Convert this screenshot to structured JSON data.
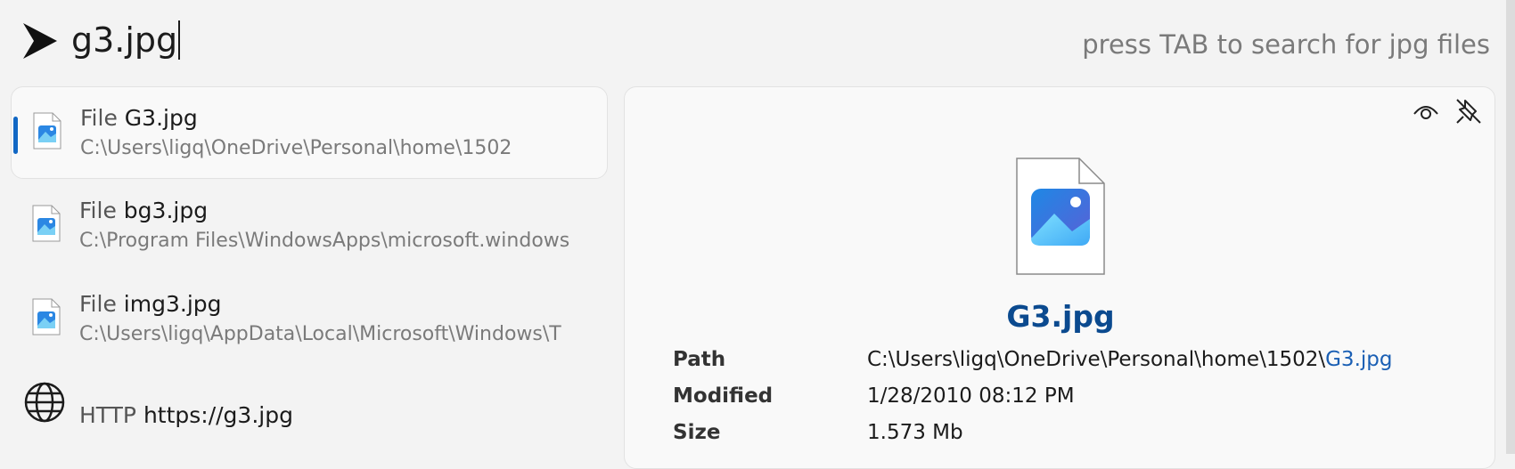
{
  "search": {
    "query": "g3.jpg",
    "hint": "press TAB to search for jpg files",
    "prompt_icon": "chevron-right-icon"
  },
  "results": [
    {
      "kind": "File",
      "name": "G3.jpg",
      "path": "C:\\Users\\ligq\\OneDrive\\Personal\\home\\1502",
      "icon": "image-file-icon",
      "selected": true
    },
    {
      "kind": "File",
      "name": "bg3.jpg",
      "path": "C:\\Program Files\\WindowsApps\\microsoft.windows",
      "icon": "image-file-icon",
      "selected": false
    },
    {
      "kind": "File",
      "name": "img3.jpg",
      "path": "C:\\Users\\ligq\\AppData\\Local\\Microsoft\\Windows\\T",
      "icon": "image-file-icon",
      "selected": false
    },
    {
      "kind": "HTTP",
      "name": "https://g3.jpg",
      "icon": "globe-icon",
      "selected": false
    }
  ],
  "preview": {
    "title": "G3.jpg",
    "path_label": "Path",
    "path_prefix": "C:\\Users\\ligq\\OneDrive\\Personal\\home\\1502\\",
    "path_file": "G3.jpg",
    "modified_label": "Modified",
    "modified_value": "1/28/2010 08:12 PM",
    "size_label": "Size",
    "size_value": "1.573 Mb",
    "icons": [
      "eye-icon",
      "pin-off-icon",
      "image-file-icon"
    ]
  },
  "colors": {
    "accent": "#1167c4",
    "title_blue": "#0b4a8f",
    "link_blue": "#1a5fb4",
    "background": "#f3f3f3"
  }
}
